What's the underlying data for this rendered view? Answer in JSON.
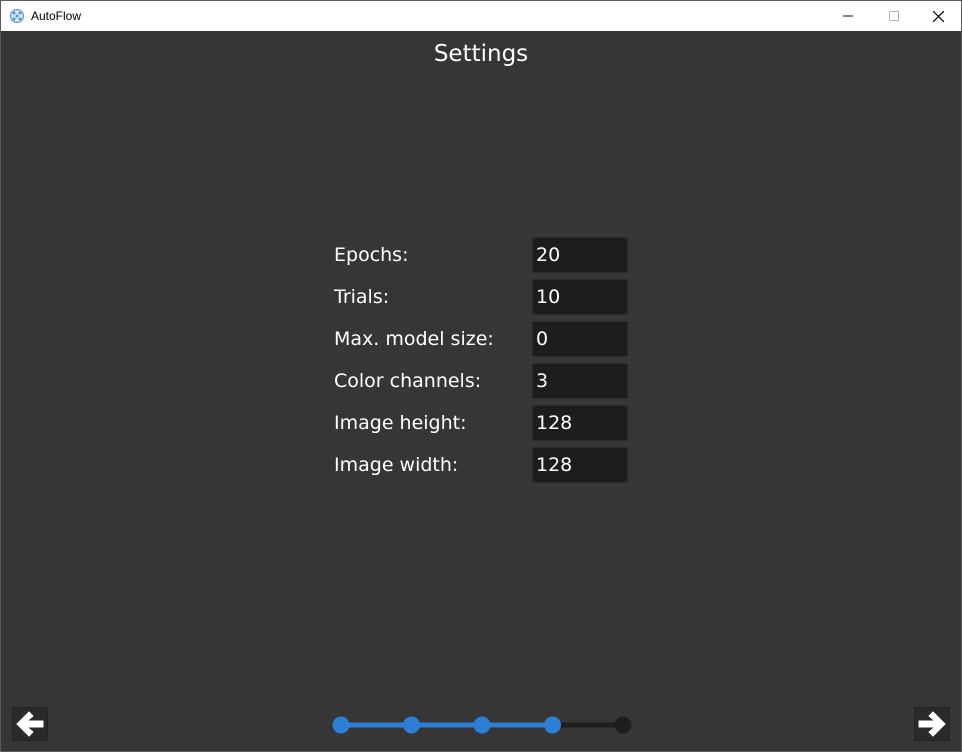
{
  "window": {
    "title": "AutoFlow",
    "controls": {
      "minimize": "minimize-icon",
      "maximize": "maximize-icon",
      "close": "close-icon"
    }
  },
  "page": {
    "title": "Settings"
  },
  "form": {
    "fields": [
      {
        "label": "Epochs:",
        "value": "20"
      },
      {
        "label": "Trials:",
        "value": "10"
      },
      {
        "label": "Max. model size:",
        "value": "0"
      },
      {
        "label": "Color channels:",
        "value": "3"
      },
      {
        "label": "Image height:",
        "value": "128"
      },
      {
        "label": "Image width:",
        "value": "128"
      }
    ]
  },
  "navigation": {
    "back_icon": "arrow-left-icon",
    "next_icon": "arrow-right-icon"
  },
  "stepper": {
    "total_steps": 5,
    "current_step": 4,
    "active_color": "#2d7fd6",
    "inactive_color": "#1e1e1e"
  },
  "colors": {
    "background": "#363636",
    "titlebar": "#ffffff",
    "input_background": "#1d1d1d",
    "accent": "#2d7fd6"
  }
}
